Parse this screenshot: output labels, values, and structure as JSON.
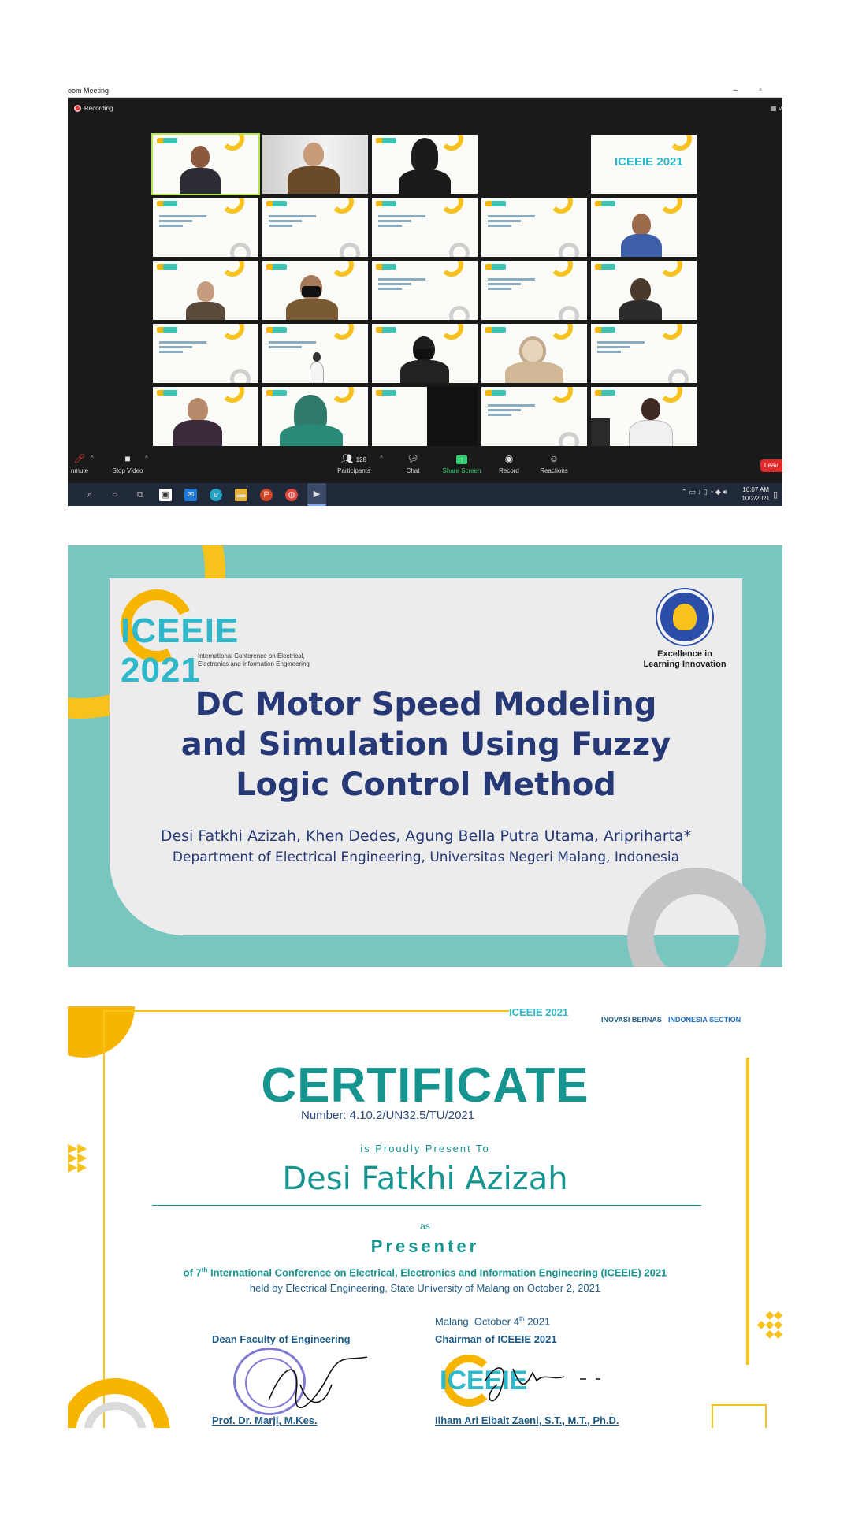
{
  "zoom": {
    "window_title": "oom Meeting",
    "recording": "Recording",
    "view_label": "V",
    "toolbar": {
      "unmute": "nmute",
      "stop_video": "Stop Video",
      "participants": "Participants",
      "participant_count": "128",
      "chat": "Chat",
      "share_screen": "Share Screen",
      "record": "Record",
      "reactions": "Reactions",
      "leave": "Leav"
    },
    "clock": {
      "time": "10:07 AM",
      "date": "10/2/2021"
    },
    "big_tile_label": "ICEEIE 2021"
  },
  "slide": {
    "logo_text": "ICEEIE 2021",
    "logo_subtitle": "International Conference on Electrical, Electronics and Information Engineering",
    "um_tagline": "Excellence in Learning Innovation",
    "title": "DC Motor Speed Modeling and Simulation Using Fuzzy Logic Control Method",
    "authors": "Desi Fatkhi Azizah, Khen Dedes,  Agung Bella Putra Utama, Aripriharta*",
    "department": "Department of Electrical Engineering, Universitas Negeri Malang, Indonesia"
  },
  "certificate": {
    "header_logos": [
      "ICEEIE 2021",
      "INOVASI BERNAS",
      "INDONESIA SECTION"
    ],
    "title": "CERTIFICATE",
    "number": "Number:  4.10.2/UN32.5/TU/2021",
    "proudly": "is Proudly Present To",
    "recipient": "Desi Fatkhi Azizah",
    "as": "as",
    "role": "Presenter",
    "of_prefix": "of 7",
    "of_sup": "th",
    "of_rest": " International Conference on Electrical, Electronics and Information Engineering (ICEEIE) 2021",
    "held": "held by Electrical Engineering, State University of Malang on October 2, 2021",
    "date_prefix": "Malang, October 4",
    "date_sup": "th",
    "date_year": " 2021",
    "signer1_role": "Dean Faculty of Engineering",
    "signer1_name": "Prof. Dr. Marji, M.Kes.",
    "signer2_role": "Chairman of ICEEIE 2021",
    "signer2_name": "Ilham Ari Elbait Zaeni, S.T., M.T., Ph.D.",
    "mini_logo": "ICEEIE"
  },
  "colors": {
    "teal": "#16948f",
    "navy": "#263876",
    "yellow": "#f7c21b",
    "slide_bg": "#79c6c0"
  }
}
